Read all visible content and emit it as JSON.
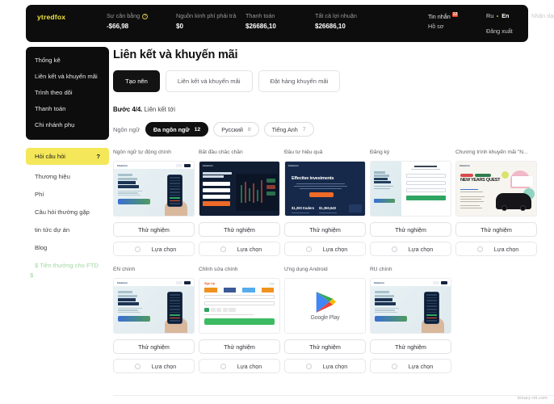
{
  "header": {
    "brand": "ytredfox",
    "stats": [
      {
        "label": "Sự cân bằng",
        "value": "-$66,98",
        "has_help_icon": true
      },
      {
        "label": "Nguồn kinh phí phải trả",
        "value": "$0",
        "has_help_icon": false
      },
      {
        "label": "Thanh toán",
        "value": "$26686,10",
        "has_help_icon": false
      },
      {
        "label": "Tất cả lợi nhuận",
        "value": "$26686,10",
        "has_help_icon": false
      }
    ],
    "messages_label": "Tin nhắn",
    "messages_badge": "22",
    "profile_label": "Hồ sơ",
    "lang_ru": "Ru",
    "lang_en": "En",
    "account_label": "Nhận dạng",
    "logout_label": "Đăng xuất"
  },
  "sidebar": {
    "primary": [
      {
        "label": "Thống kê"
      },
      {
        "label": "Liên kết và khuyến mãi"
      },
      {
        "label": "Trình theo dõi"
      },
      {
        "label": "Thanh toán"
      },
      {
        "label": "Chi nhánh phụ"
      }
    ],
    "help": {
      "label": "Hỏi câu hỏi",
      "mark": "?"
    },
    "secondary": [
      {
        "label": "Thương hiệu",
        "promo": false
      },
      {
        "label": "Phí",
        "promo": false
      },
      {
        "label": "Câu hỏi thường gặp",
        "promo": false
      },
      {
        "label": "tin tức dự án",
        "promo": false
      },
      {
        "label": "Blog",
        "promo": false
      },
      {
        "label": "$ Tiền thưởng cho FTD",
        "promo": true
      }
    ],
    "currency_mark": "$"
  },
  "main": {
    "title": "Liên kết và khuyến mãi",
    "tabs": [
      {
        "label": "Tạo nên",
        "active": true
      },
      {
        "label": "Liên kết và khuyến mãi",
        "active": false
      },
      {
        "label": "Đặt hàng khuyến mãi",
        "active": false
      }
    ],
    "step_prefix": "Bước 4/4.",
    "step_text": "Liên kết tới",
    "lang_caption": "Ngôn ngữ",
    "lang_chips": [
      {
        "label": "Đa ngôn ngữ",
        "count": "12",
        "active": true
      },
      {
        "label": "Русский",
        "count": "8",
        "active": false
      },
      {
        "label": "Tiếng Anh",
        "count": "7",
        "active": false
      }
    ],
    "card_actions": {
      "test": "Thử nghiệm",
      "choose": "Lựa chọn"
    },
    "cards_row1": [
      {
        "label": "Ngôn ngữ tự động chính",
        "art": "A"
      },
      {
        "label": "Bắt đầu chắc chắn",
        "art": "B"
      },
      {
        "label": "Đầu tư hiệu quả",
        "art": "C"
      },
      {
        "label": "Đăng ký",
        "art": "D"
      },
      {
        "label": "Chương trình khuyến mãi \"N...",
        "art": "E"
      }
    ],
    "cards_row2": [
      {
        "label": "EN chính",
        "art": "A"
      },
      {
        "label": "Chỉnh sửa chính",
        "art": "F"
      },
      {
        "label": "Ứng dụng Android",
        "art": "G"
      },
      {
        "label": "RU chính",
        "art": "H"
      }
    ],
    "thumb_text": {
      "effective_title": "Effective investments",
      "effective_stat1": "$1,200 traders",
      "effective_stat2": "$1,350,640",
      "quest_title": "NEW YEARS QUEST",
      "google_play": "Google Play",
      "signup_header": "Sign Up",
      "signup_login": "Login",
      "signup_cta": "OPEN AN ACCOUNT FOR FREE"
    }
  },
  "watermark": "binary-oli.com",
  "colors": {
    "dark": "#0d0d0d",
    "accent_yellow": "#f4e759",
    "brand_yellow": "#f2e53d",
    "badge_red": "#e8431f",
    "promo_green": "#9ed7a0"
  }
}
